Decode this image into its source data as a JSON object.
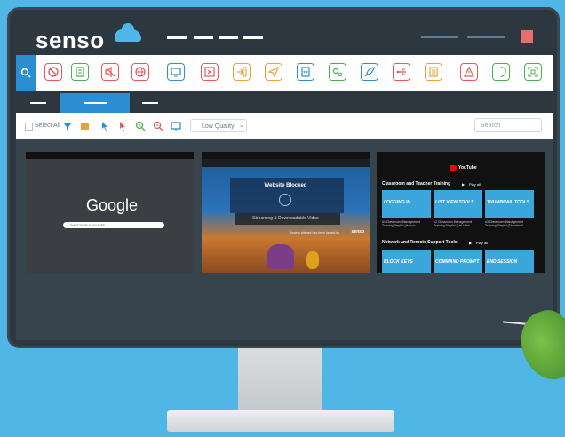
{
  "brand": {
    "name": "senso",
    "cloud_color": "#4fb8e8"
  },
  "colors": {
    "accent": "#2a8ed0",
    "danger": "#e96d6d",
    "frame": "#2c3740"
  },
  "toolbar": {
    "tools": [
      {
        "icon": "block-icon",
        "color": "#e45b5b"
      },
      {
        "icon": "document-list-icon",
        "color": "#4caf50"
      },
      {
        "icon": "mute-icon",
        "color": "#e45b5b"
      },
      {
        "icon": "globe-icon",
        "color": "#e45b5b"
      },
      {
        "icon": "screen-share-icon",
        "color": "#2a8ed0"
      },
      {
        "icon": "close-window-icon",
        "color": "#e45b5b"
      },
      {
        "icon": "open-url-icon",
        "color": "#e9a23b"
      },
      {
        "icon": "send-icon",
        "color": "#e9a23b"
      },
      {
        "icon": "code-file-icon",
        "color": "#2a8ed0"
      },
      {
        "icon": "settings-icon",
        "color": "#4caf50"
      },
      {
        "icon": "rocket-icon",
        "color": "#2a8ed0"
      },
      {
        "icon": "usb-icon",
        "color": "#e45b5b"
      },
      {
        "icon": "list-icon",
        "color": "#e9a23b"
      },
      {
        "icon": "warning-icon",
        "color": "#e45b5b"
      },
      {
        "icon": "shield-icon",
        "color": "#4caf50"
      },
      {
        "icon": "scan-icon",
        "color": "#4caf50"
      }
    ]
  },
  "controls": {
    "select_all": "Select All",
    "quality": "Low Quality",
    "search_placeholder": "Search"
  },
  "thumbnails": {
    "google": {
      "logo": "Google",
      "search": "Search Google or type a URL"
    },
    "blocked": {
      "title": "Website Blocked",
      "category": "Streaming & Downloadable Video",
      "footer": "Access attempt has been logged by",
      "brand": "senso"
    },
    "youtube": {
      "brand": "YouTube",
      "section1": "Classroom and Teacher Training",
      "section2": "Network and Remote Support Tools",
      "play_all": "Play all",
      "videos": [
        {
          "card": "LOGGING IN",
          "caption": "#1 Classroom Management Training Playlist (How to..."
        },
        {
          "card": "LIST VIEW TOOLS",
          "caption": "#2 Classroom Management Training Playlist (List View..."
        },
        {
          "card": "THUMBNAIL TOOLS",
          "caption": "#3 Classroom Management Training Playlist (Thumbnail..."
        },
        {
          "card": "BLOCK KEYS",
          "caption": ""
        },
        {
          "card": "COMMAND PROMPT",
          "caption": ""
        },
        {
          "card": "END SESSION",
          "caption": ""
        }
      ]
    }
  }
}
